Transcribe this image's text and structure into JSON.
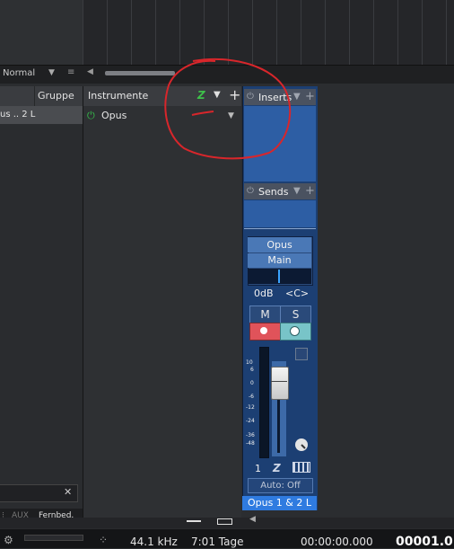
{
  "toolbar": {
    "mode_value": "Normal"
  },
  "left_panel": {
    "column_header_group": "Gruppe",
    "row_text": "us .. 2 L",
    "bottom_tabs": [
      "AUX",
      "Fernbed."
    ]
  },
  "instruments": {
    "title": "Instrumente",
    "items": [
      {
        "label": "Opus"
      }
    ]
  },
  "channel": {
    "inserts_label": "Inserts",
    "sends_label": "Sends",
    "name": "Opus",
    "output": "Main",
    "volume": "0dB",
    "pan": "<C>",
    "mute_label": "M",
    "solo_label": "S",
    "scale_ticks": [
      "10",
      "6",
      "0",
      "-6",
      "-12",
      "-24",
      "-36",
      "-48"
    ],
    "number": "1",
    "automation": "Auto: Off",
    "footer": "Opus 1 & 2 L"
  },
  "transport": {
    "sample_rate": "44.1 kHz",
    "record_time": "7:01 Tage",
    "time": "00:00:00.000",
    "counter": "00001.0"
  },
  "colors": {
    "channel_blue": "#2d5ea4",
    "footer_blue": "#2f7be0",
    "record_red": "#e0535a",
    "monitor_teal": "#78c4c8",
    "power_green": "#35c04a",
    "annotation_red": "#d8262b"
  },
  "icons": {
    "instrument_z": "Z",
    "power": "⏻"
  }
}
